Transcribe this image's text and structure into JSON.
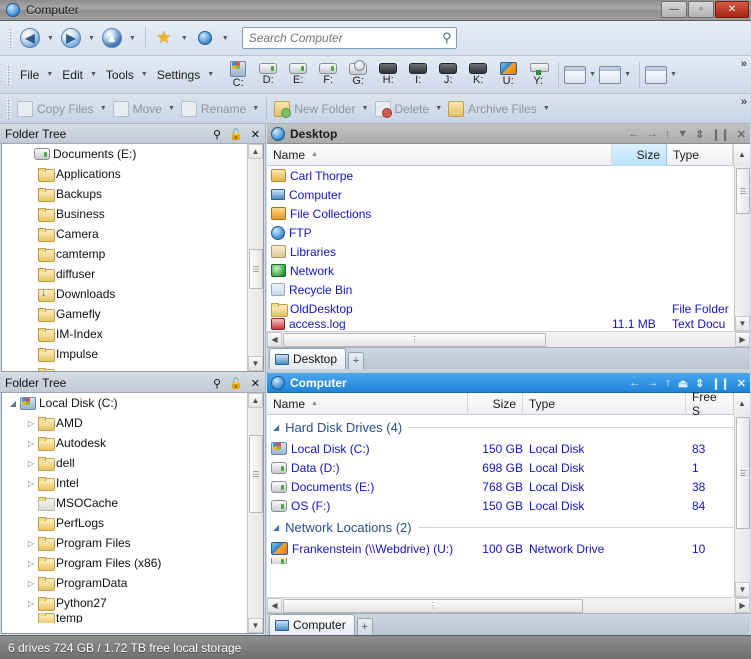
{
  "window": {
    "title": "Computer",
    "icon": "app-globe-icon",
    "controls": {
      "minimize": "—",
      "maximize": "▫",
      "close": "✕"
    }
  },
  "navbar": {
    "back": {
      "name": "back-button",
      "glyph": "◀"
    },
    "forward": {
      "name": "forward-button",
      "glyph": "▶"
    },
    "up": {
      "name": "up-button",
      "glyph": "▲"
    },
    "favorites": {
      "name": "favorites-star-icon",
      "glyph": "★"
    },
    "computer": {
      "name": "computer-icon"
    },
    "dropdown_glyph": "▼",
    "search": {
      "placeholder": "Search Computer",
      "value": "",
      "icon": "search-icon"
    }
  },
  "menubar": {
    "items": [
      {
        "label": "File"
      },
      {
        "label": "Edit"
      },
      {
        "label": "Tools"
      },
      {
        "label": "Settings"
      }
    ],
    "drives": [
      {
        "label": "C:",
        "icon": "windows-drive-icon"
      },
      {
        "label": "D:",
        "icon": "hard-drive-icon"
      },
      {
        "label": "E:",
        "icon": "hard-drive-icon"
      },
      {
        "label": "F:",
        "icon": "hard-drive-icon"
      },
      {
        "label": "G:",
        "icon": "optical-drive-icon"
      },
      {
        "label": "H:",
        "icon": "removable-drive-icon"
      },
      {
        "label": "I:",
        "icon": "removable-drive-icon"
      },
      {
        "label": "J:",
        "icon": "removable-drive-icon"
      },
      {
        "label": "K:",
        "icon": "removable-drive-icon"
      },
      {
        "label": "U:",
        "icon": "network-drive-icon"
      },
      {
        "label": "Y:",
        "icon": "server-drive-icon"
      }
    ],
    "right_tools": [
      {
        "name": "preview-pane-button",
        "icon": "image-window-icon"
      },
      {
        "name": "help-button",
        "icon": "question-pencil-icon"
      },
      {
        "name": "layout-button",
        "icon": "split-pane-icon"
      }
    ],
    "overflow_glyph": "»"
  },
  "toolbar2": {
    "items": [
      {
        "label": "Copy Files",
        "icon": "copy-icon",
        "disabled": true
      },
      {
        "label": "Move",
        "icon": "move-icon",
        "disabled": true
      },
      {
        "label": "Rename",
        "icon": "rename-icon",
        "disabled": true
      },
      {
        "label": "New Folder",
        "icon": "new-folder-icon",
        "disabled": true
      },
      {
        "label": "Delete",
        "icon": "delete-icon",
        "disabled": true
      },
      {
        "label": "Archive Files",
        "icon": "archive-icon",
        "disabled": true
      }
    ],
    "dropdown_glyph": "▼",
    "overflow_glyph": "»"
  },
  "tree_top": {
    "header": {
      "title": "Folder Tree",
      "search_icon": "search-icon",
      "lock_icon": "unlock-icon",
      "close_icon": "close-icon"
    },
    "items": [
      {
        "label": "Documents (E:)",
        "icon": "hard-drive-icon",
        "indent": 1,
        "twisty": ""
      },
      {
        "label": "Applications",
        "icon": "folder-icon",
        "indent": 2,
        "twisty": ""
      },
      {
        "label": "Backups",
        "icon": "folder-icon",
        "indent": 2,
        "twisty": ""
      },
      {
        "label": "Business",
        "icon": "folder-icon",
        "indent": 2,
        "twisty": ""
      },
      {
        "label": "Camera",
        "icon": "folder-icon",
        "indent": 2,
        "twisty": ""
      },
      {
        "label": "camtemp",
        "icon": "folder-icon",
        "indent": 2,
        "twisty": ""
      },
      {
        "label": "diffuser",
        "icon": "folder-icon",
        "indent": 2,
        "twisty": ""
      },
      {
        "label": "Downloads",
        "icon": "downloads-folder-icon",
        "indent": 2,
        "twisty": ""
      },
      {
        "label": "Gamefly",
        "icon": "folder-icon",
        "indent": 2,
        "twisty": ""
      },
      {
        "label": "IM-Index",
        "icon": "folder-icon",
        "indent": 2,
        "twisty": ""
      },
      {
        "label": "Impulse",
        "icon": "folder-icon",
        "indent": 2,
        "twisty": ""
      }
    ]
  },
  "tree_bottom": {
    "header": {
      "title": "Folder Tree",
      "search_icon": "search-icon",
      "lock_icon": "unlock-icon",
      "close_icon": "close-icon"
    },
    "items": [
      {
        "label": "Local Disk (C:)",
        "icon": "windows-drive-icon",
        "indent": 0,
        "twisty": "◢"
      },
      {
        "label": "AMD",
        "icon": "folder-icon",
        "indent": 1,
        "twisty": "▷"
      },
      {
        "label": "Autodesk",
        "icon": "folder-icon",
        "indent": 1,
        "twisty": "▷"
      },
      {
        "label": "dell",
        "icon": "folder-icon",
        "indent": 1,
        "twisty": "▷"
      },
      {
        "label": "Intel",
        "icon": "folder-icon",
        "indent": 1,
        "twisty": "▷"
      },
      {
        "label": "MSOCache",
        "icon": "folder-icon-grey",
        "indent": 1,
        "twisty": ""
      },
      {
        "label": "PerfLogs",
        "icon": "folder-icon",
        "indent": 1,
        "twisty": ""
      },
      {
        "label": "Program Files",
        "icon": "folder-icon",
        "indent": 1,
        "twisty": "▷"
      },
      {
        "label": "Program Files (x86)",
        "icon": "folder-icon",
        "indent": 1,
        "twisty": "▷"
      },
      {
        "label": "ProgramData",
        "icon": "folder-icon",
        "indent": 1,
        "twisty": "▷"
      },
      {
        "label": "Python27",
        "icon": "folder-icon",
        "indent": 1,
        "twisty": "▷"
      },
      {
        "label": "temp",
        "icon": "folder-icon",
        "indent": 1,
        "twisty": ""
      }
    ]
  },
  "panel_desktop": {
    "title": "Desktop",
    "active": false,
    "titlebar_buttons": [
      {
        "name": "panel-back-button",
        "glyph": "←"
      },
      {
        "name": "panel-forward-button",
        "glyph": "→"
      },
      {
        "name": "panel-up-button",
        "glyph": "↑"
      },
      {
        "name": "panel-collapse-button",
        "glyph": "▼"
      },
      {
        "name": "panel-sync-button",
        "glyph": "⇕"
      },
      {
        "name": "panel-pause-button",
        "glyph": "❙❙"
      },
      {
        "name": "panel-close-button",
        "glyph": "✕"
      }
    ],
    "columns": [
      {
        "label": "Name",
        "sort": "▲",
        "highlight": false
      },
      {
        "label": "Size",
        "sort": "",
        "highlight": true
      },
      {
        "label": "Type",
        "sort": "",
        "highlight": false
      }
    ],
    "rows": [
      {
        "name": "Carl Thorpe",
        "icon": "user-folder-icon",
        "size": "",
        "type": ""
      },
      {
        "name": "Computer",
        "icon": "computer-icon",
        "size": "",
        "type": ""
      },
      {
        "name": "File Collections",
        "icon": "collections-icon",
        "size": "",
        "type": ""
      },
      {
        "name": "FTP",
        "icon": "globe-icon",
        "size": "",
        "type": ""
      },
      {
        "name": "Libraries",
        "icon": "libraries-icon",
        "size": "",
        "type": ""
      },
      {
        "name": "Network",
        "icon": "network-icon",
        "size": "",
        "type": ""
      },
      {
        "name": "Recycle Bin",
        "icon": "recycle-bin-icon",
        "size": "",
        "type": ""
      },
      {
        "name": "OldDesktop",
        "icon": "folder-icon",
        "size": "",
        "type": "File Folder"
      },
      {
        "name": "access.log",
        "icon": "log-file-icon",
        "size": "11.1 MB",
        "type": "Text Docu"
      }
    ],
    "tab": {
      "label": "Desktop",
      "icon": "computer-icon"
    },
    "new_tab_glyph": "+"
  },
  "panel_computer": {
    "title": "Computer",
    "active": true,
    "titlebar_buttons": [
      {
        "name": "panel-back-button",
        "glyph": "←"
      },
      {
        "name": "panel-forward-button",
        "glyph": "→"
      },
      {
        "name": "panel-up-button",
        "glyph": "↑"
      },
      {
        "name": "panel-eject-button",
        "glyph": "⏏"
      },
      {
        "name": "panel-sync-button",
        "glyph": "⇕"
      },
      {
        "name": "panel-pause-button",
        "glyph": "❙❙"
      },
      {
        "name": "panel-close-button",
        "glyph": "✕"
      }
    ],
    "columns": [
      {
        "label": "Name",
        "sort": "▲"
      },
      {
        "label": "Size",
        "sort": ""
      },
      {
        "label": "Type",
        "sort": ""
      },
      {
        "label": "Free S",
        "sort": ""
      }
    ],
    "groups": [
      {
        "label": "Hard Disk Drives (4)",
        "collapse_glyph": "◢",
        "rows": [
          {
            "name": "Local Disk (C:)",
            "icon": "windows-drive-icon",
            "size": "150 GB",
            "type": "Local Disk",
            "free": "83"
          },
          {
            "name": "Data (D:)",
            "icon": "hard-drive-icon",
            "size": "698 GB",
            "type": "Local Disk",
            "free": "1"
          },
          {
            "name": "Documents (E:)",
            "icon": "hard-drive-icon",
            "size": "768 GB",
            "type": "Local Disk",
            "free": "38"
          },
          {
            "name": "OS (F:)",
            "icon": "hard-drive-icon",
            "size": "150 GB",
            "type": "Local Disk",
            "free": "84"
          }
        ]
      },
      {
        "label": "Network Locations (2)",
        "collapse_glyph": "◢",
        "rows": [
          {
            "name": "Frankenstein (\\\\Webdrive) (U:)",
            "icon": "network-drive-icon",
            "size": "100 GB",
            "type": "Network Drive",
            "free": "10"
          }
        ]
      }
    ],
    "tab": {
      "label": "Computer",
      "icon": "computer-icon"
    },
    "new_tab_glyph": "+"
  },
  "statusbar": {
    "text": "6 drives  724 GB / 1.72 TB free local storage"
  },
  "colors": {
    "active_panel": "#2f8fda",
    "inactive_panel": "#ababab",
    "link_text": "#1414c8",
    "group_header": "#2a4f8f",
    "column_highlight": "#b9e4fb",
    "close_button": "#a52414"
  }
}
